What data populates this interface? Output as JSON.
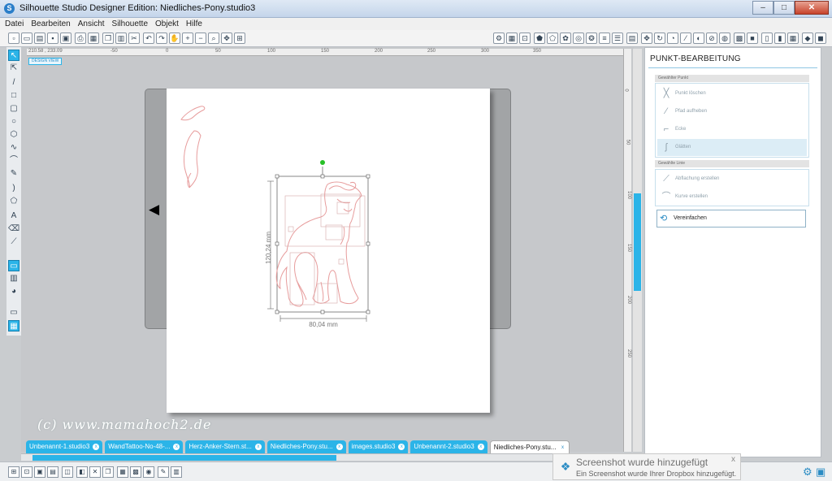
{
  "window": {
    "title": "Silhouette Studio Designer Edition: Niedliches-Pony.studio3"
  },
  "menu": [
    "Datei",
    "Bearbeiten",
    "Ansicht",
    "Silhouette",
    "Objekt",
    "Hilfe"
  ],
  "ruler": {
    "coords": "210.58 , 233.09",
    "top_labels": [
      "-50",
      "0",
      "50",
      "100",
      "150",
      "200",
      "250",
      "300",
      "350"
    ],
    "side_labels": [
      "0",
      "50",
      "100",
      "150",
      "200",
      "250"
    ]
  },
  "canvas": {
    "view_label": "DESIGN VIEW",
    "height_dim": "120,24 mm",
    "width_dim": "80,04 mm",
    "watermark": "(c) www.mamahoch2.de"
  },
  "tabs": [
    {
      "label": "Unbenannt-1.studio3",
      "active": false
    },
    {
      "label": "WandTattoo-No-48-...",
      "active": false
    },
    {
      "label": "Herz-Anker-Stern.st...",
      "active": false
    },
    {
      "label": "Niedliches-Pony.stu...",
      "active": false
    },
    {
      "label": "images.studio3",
      "active": false
    },
    {
      "label": "Unbenannt-2.studio3",
      "active": false
    },
    {
      "label": "Niedliches-Pony.stu...",
      "active": true
    }
  ],
  "panel": {
    "title": "PUNKT-BEARBEITUNG",
    "section_point": "Gewählter Punkt",
    "point_items": [
      {
        "label": "Punkt löschen",
        "icon": "x-point-icon"
      },
      {
        "label": "Pfad aufheben",
        "icon": "break-path-icon"
      },
      {
        "label": "Ecke",
        "icon": "corner-icon"
      },
      {
        "label": "Glätten",
        "icon": "smooth-icon"
      }
    ],
    "section_line": "Gewählte Linie",
    "line_items": [
      {
        "label": "Abflachung erstellen",
        "icon": "flatten-icon"
      },
      {
        "label": "Kurve erstellen",
        "icon": "curve-icon"
      }
    ],
    "simplify": "Vereinfachen"
  },
  "notification": {
    "title": "Screenshot wurde hinzugefügt",
    "message": "Ein Screenshot wurde Ihrer Dropbox hinzugefügt.",
    "close": "x"
  },
  "colors": {
    "accent": "#2bb4e8",
    "shape_stroke": "#e79c9c",
    "selection": "#6a6a6a",
    "rotate_handle": "#27c027"
  }
}
